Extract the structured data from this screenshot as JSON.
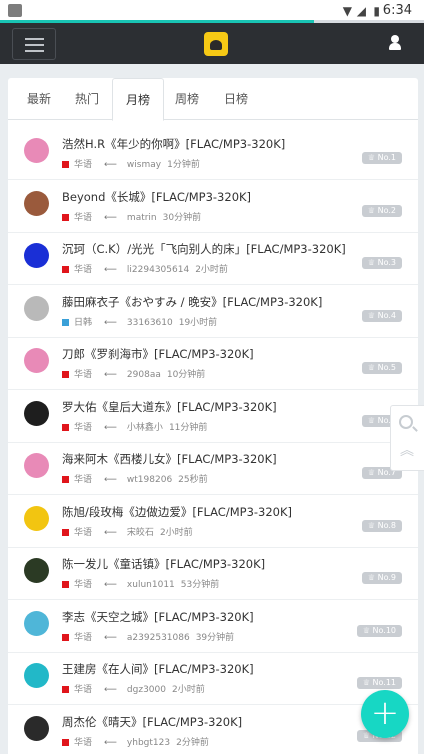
{
  "status_bar": {
    "time": "6:34"
  },
  "page_progress": 0.74,
  "tabs": [
    "最新",
    "热门",
    "月榜",
    "周榜",
    "日榜"
  ],
  "active_tab": "月榜",
  "fab_label": "+",
  "items": [
    {
      "title": "浩然H.R《年少的你啊》[FLAC/MP3-320K]",
      "lang": "华语",
      "user": "wismay",
      "time": "1分钟前",
      "rank": "No.1",
      "lang_color": "#e0151b",
      "avatar_color": "#e88ab7"
    },
    {
      "title": "Beyond《长城》[FLAC/MP3-320K]",
      "lang": "华语",
      "user": "matrin",
      "time": "30分钟前",
      "rank": "No.2",
      "lang_color": "#e0151b",
      "avatar_color": "#9a5a3c"
    },
    {
      "title": "沉珂（C.K）/光光「飞向别人的床」[FLAC/MP3-320K]",
      "lang": "华语",
      "user": "li2294305614",
      "time": "2小时前",
      "rank": "No.3",
      "lang_color": "#e0151b",
      "avatar_color": "#1a2fd6"
    },
    {
      "title": "藤田麻衣子《おやすみ / 晚安》[FLAC/MP3-320K]",
      "lang": "日韩",
      "user": "33163610",
      "time": "19小时前",
      "rank": "No.4",
      "lang_color": "#3aa0d8",
      "avatar_color": "#b9b9b9"
    },
    {
      "title": "刀郎《罗刹海市》[FLAC/MP3-320K]",
      "lang": "华语",
      "user": "2908aa",
      "time": "10分钟前",
      "rank": "No.5",
      "lang_color": "#e0151b",
      "avatar_color": "#e88ab7"
    },
    {
      "title": "罗大佑《皇后大道东》[FLAC/MP3-320K]",
      "lang": "华语",
      "user": "小林鑫小",
      "time": "11分钟前",
      "rank": "No.6",
      "lang_color": "#e0151b",
      "avatar_color": "#1e1e1e"
    },
    {
      "title": "海来阿木《西楼儿女》[FLAC/MP3-320K]",
      "lang": "华语",
      "user": "wt198206",
      "time": "25秒前",
      "rank": "No.7",
      "lang_color": "#e0151b",
      "avatar_color": "#e88ab7"
    },
    {
      "title": "陈旭/段玫梅《边做边爱》[FLAC/MP3-320K]",
      "lang": "华语",
      "user": "宋皎石",
      "time": "2小时前",
      "rank": "No.8",
      "lang_color": "#e0151b",
      "avatar_color": "#f2c511"
    },
    {
      "title": "陈一发儿《童话镇》[FLAC/MP3-320K]",
      "lang": "华语",
      "user": "xulun1011",
      "time": "53分钟前",
      "rank": "No.9",
      "lang_color": "#e0151b",
      "avatar_color": "#2b3a24"
    },
    {
      "title": "李志《天空之城》[FLAC/MP3-320K]",
      "lang": "华语",
      "user": "a2392531086",
      "time": "39分钟前",
      "rank": "No.10",
      "lang_color": "#e0151b",
      "avatar_color": "#4fb6d8"
    },
    {
      "title": "王建房《在人间》[FLAC/MP3-320K]",
      "lang": "华语",
      "user": "dgz3000",
      "time": "2小时前",
      "rank": "No.11",
      "lang_color": "#e0151b",
      "avatar_color": "#22b8c8"
    },
    {
      "title": "周杰伦《晴天》[FLAC/MP3-320K]",
      "lang": "华语",
      "user": "yhbgt123",
      "time": "2分钟前",
      "rank": "No.12",
      "lang_color": "#e0151b",
      "avatar_color": "#2a2a2a"
    }
  ]
}
